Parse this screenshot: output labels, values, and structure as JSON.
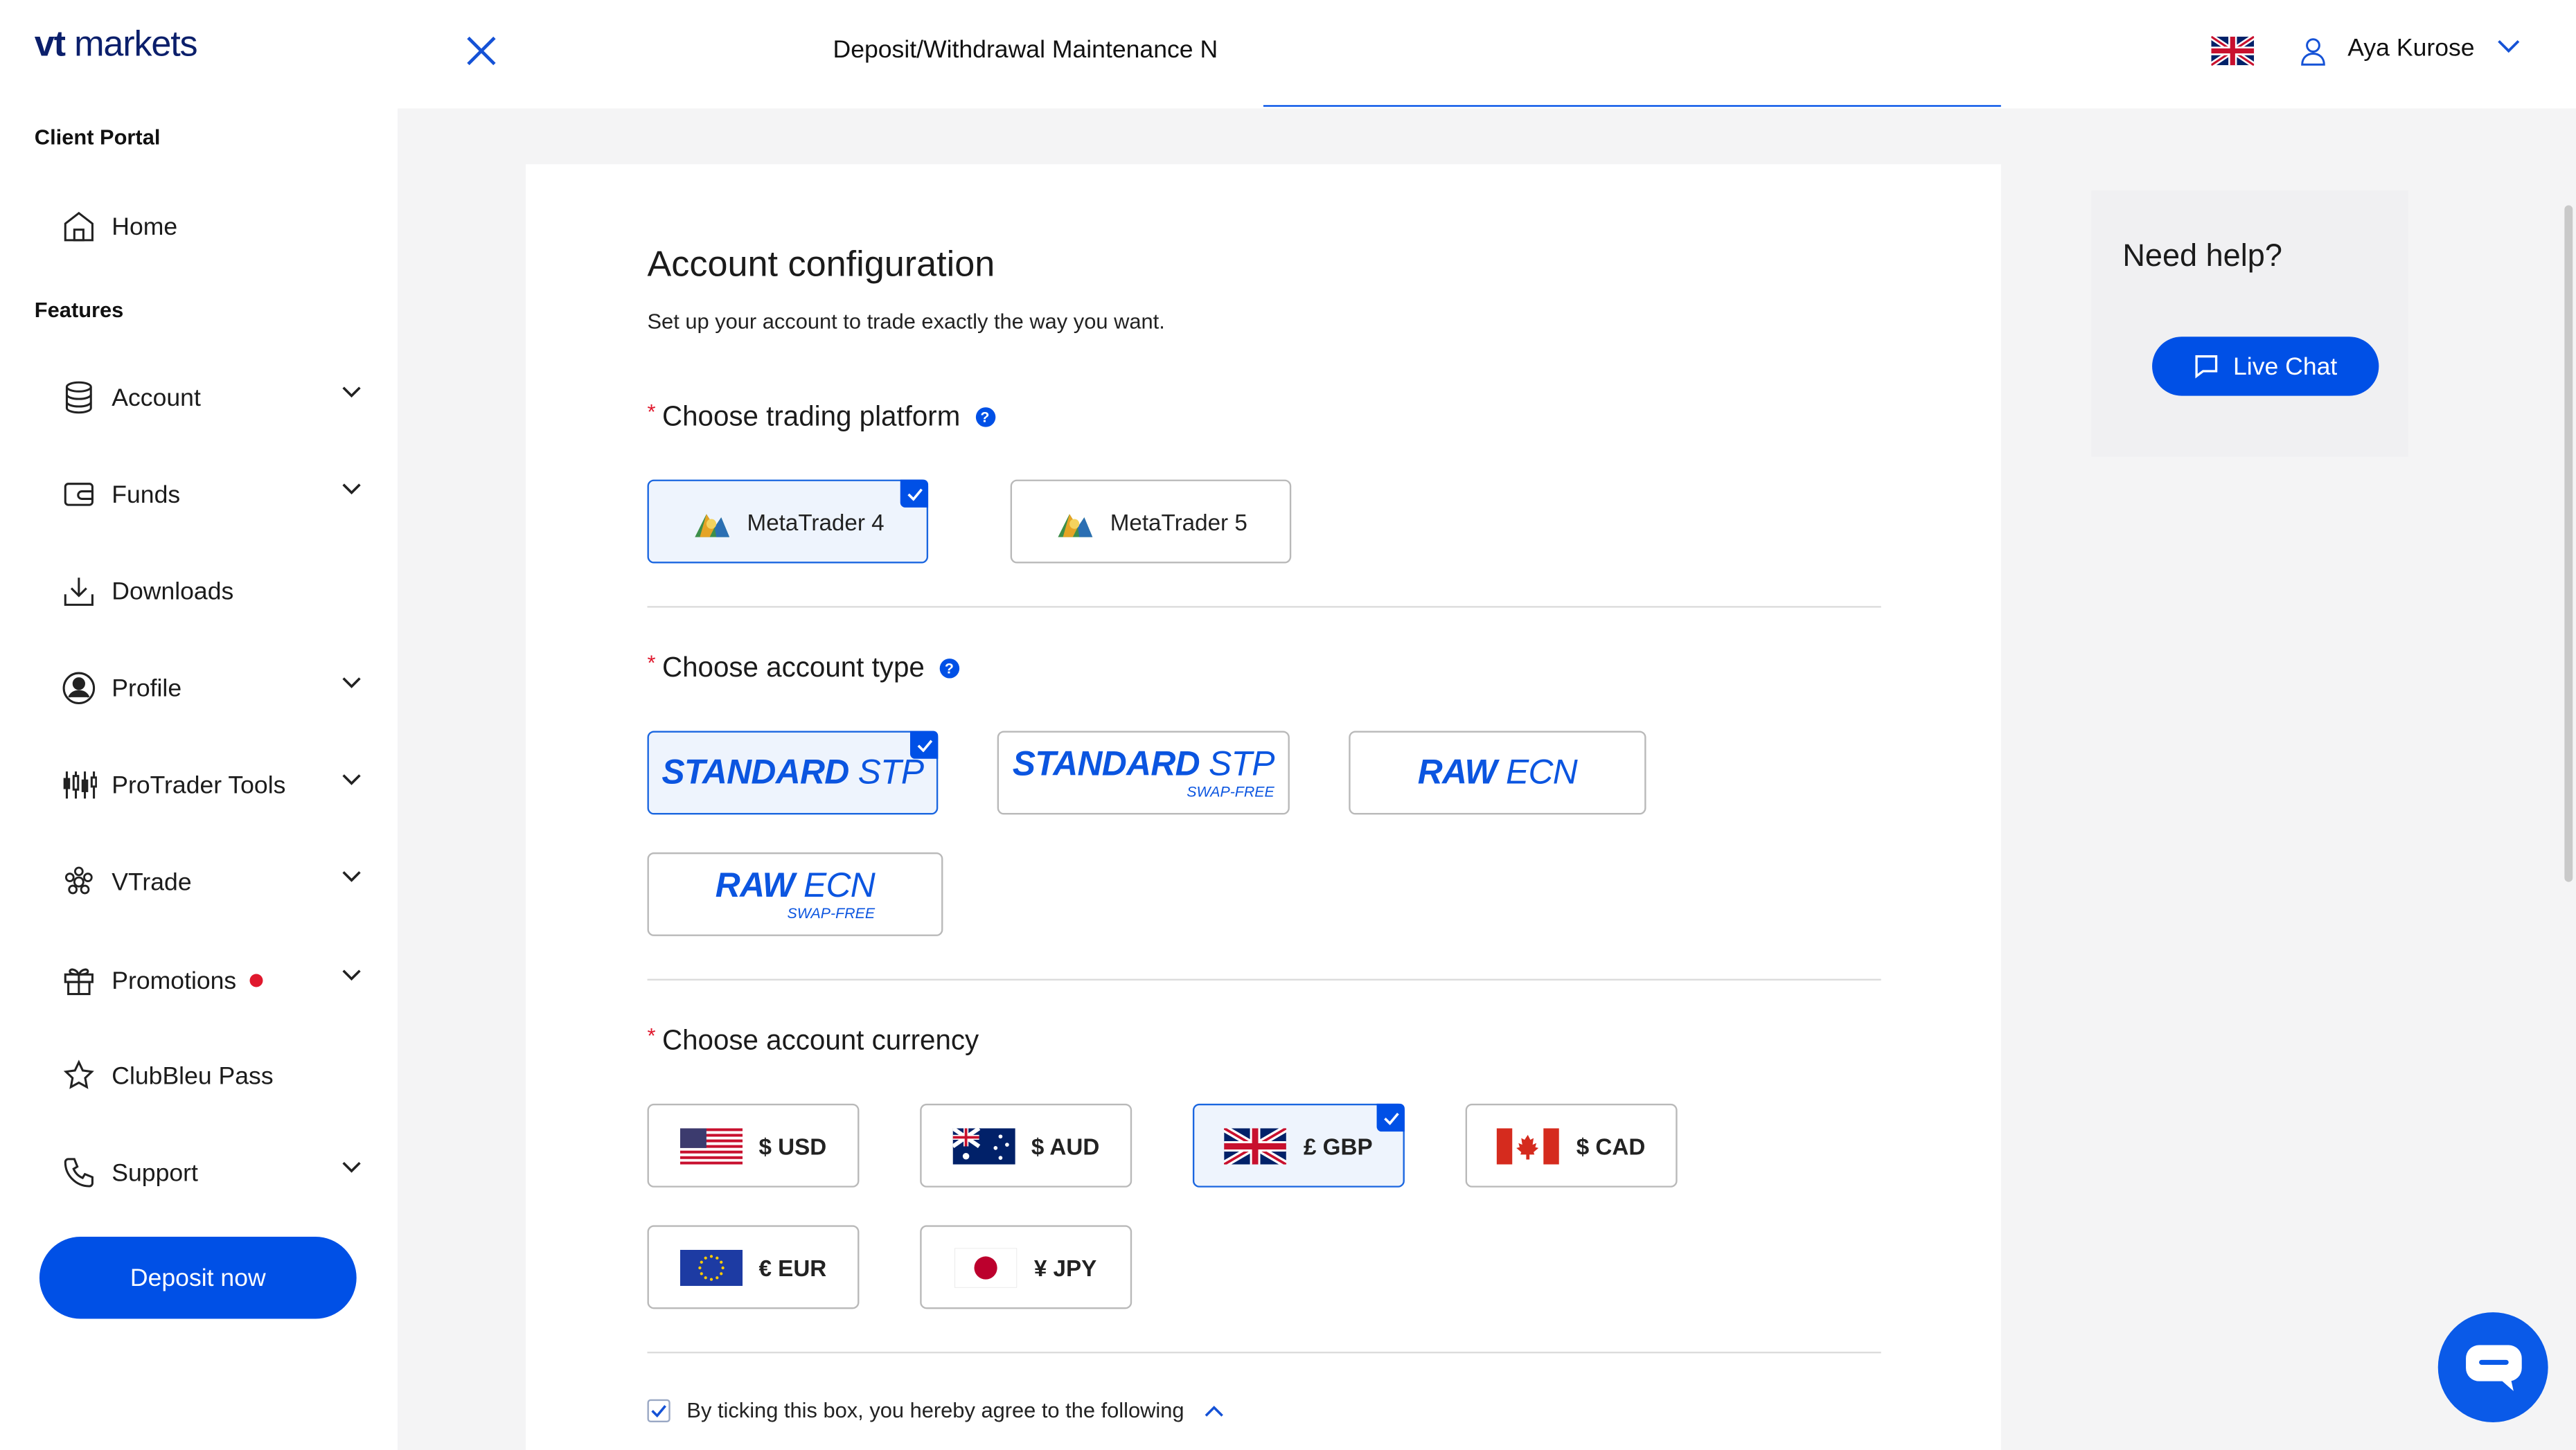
{
  "brand": {
    "logo_bold": "vt",
    "logo_rest": " markets",
    "accent": "#0050e6"
  },
  "sidebar": {
    "section_client": "Client Portal",
    "section_features": "Features",
    "items": [
      {
        "label": "Home",
        "icon": "home-icon"
      },
      {
        "label": "Account",
        "icon": "database-icon",
        "expandable": true
      },
      {
        "label": "Funds",
        "icon": "wallet-icon",
        "expandable": true
      },
      {
        "label": "Downloads",
        "icon": "download-icon"
      },
      {
        "label": "Profile",
        "icon": "user-circle-icon",
        "expandable": true
      },
      {
        "label": "ProTrader Tools",
        "icon": "candlestick-icon",
        "expandable": true
      },
      {
        "label": "VTrade",
        "icon": "vtrade-icon",
        "expandable": true
      },
      {
        "label": "Promotions",
        "icon": "gift-icon",
        "expandable": true,
        "badge": true
      },
      {
        "label": "ClubBleu Pass",
        "icon": "star-icon"
      },
      {
        "label": "Support",
        "icon": "phone-icon",
        "expandable": true
      }
    ],
    "deposit_button": "Deposit now"
  },
  "header": {
    "marquee": "Deposit/Withdrawal Maintenance N",
    "language": "English (UK)",
    "user_name": "Aya Kurose"
  },
  "main": {
    "title": "Account configuration",
    "subtitle": "Set up your account to trade exactly the way you want.",
    "platform": {
      "label": "Choose trading platform",
      "options": [
        {
          "label": "MetaTrader 4",
          "selected": true
        },
        {
          "label": "MetaTrader 5",
          "selected": false
        }
      ]
    },
    "account_type": {
      "label": "Choose account type",
      "options": [
        {
          "bold": "STANDARD",
          "rest": " STP",
          "sub": "",
          "selected": true
        },
        {
          "bold": "STANDARD",
          "rest": " STP",
          "sub": "SWAP-FREE",
          "selected": false
        },
        {
          "bold": "RAW",
          "rest": " ECN",
          "sub": "",
          "selected": false
        },
        {
          "bold": "RAW",
          "rest": " ECN",
          "sub": "SWAP-FREE",
          "selected": false
        }
      ]
    },
    "currency": {
      "label": "Choose account currency",
      "options": [
        {
          "label": "$ USD",
          "flag": "us-flag-icon",
          "selected": false
        },
        {
          "label": "$ AUD",
          "flag": "au-flag-icon",
          "selected": false
        },
        {
          "label": "£ GBP",
          "flag": "uk-flag-icon",
          "selected": true
        },
        {
          "label": "$ CAD",
          "flag": "ca-flag-icon",
          "selected": false
        },
        {
          "label": "€ EUR",
          "flag": "eu-flag-icon",
          "selected": false
        },
        {
          "label": "¥ JPY",
          "flag": "jp-flag-icon",
          "selected": false
        }
      ]
    },
    "agreement": "By ticking this box, you hereby agree to the following"
  },
  "help": {
    "title": "Need help?",
    "live_chat": "Live Chat"
  }
}
